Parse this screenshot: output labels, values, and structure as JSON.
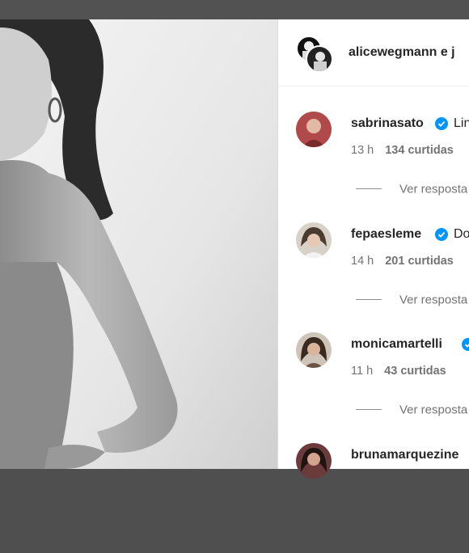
{
  "post": {
    "header": {
      "username": "alicewegmann e j"
    },
    "comments": [
      {
        "username": "sabrinasato",
        "verified": true,
        "text": "Lin",
        "time": "13 h",
        "likes": "134 curtidas",
        "replies_label": "Ver resposta"
      },
      {
        "username": "fepaesleme",
        "verified": true,
        "text": "Do",
        "time": "14 h",
        "likes": "201 curtidas",
        "replies_label": "Ver resposta"
      },
      {
        "username": "monicamartelli",
        "verified": true,
        "text": "",
        "time": "11 h",
        "likes": "43 curtidas",
        "replies_label": "Ver resposta"
      },
      {
        "username": "brunamarquezine",
        "verified": false,
        "text": "",
        "time": "",
        "likes": "",
        "replies_label": ""
      }
    ]
  },
  "colors": {
    "verified": "#0095f6",
    "text": "#262626",
    "secondary": "#737373"
  }
}
